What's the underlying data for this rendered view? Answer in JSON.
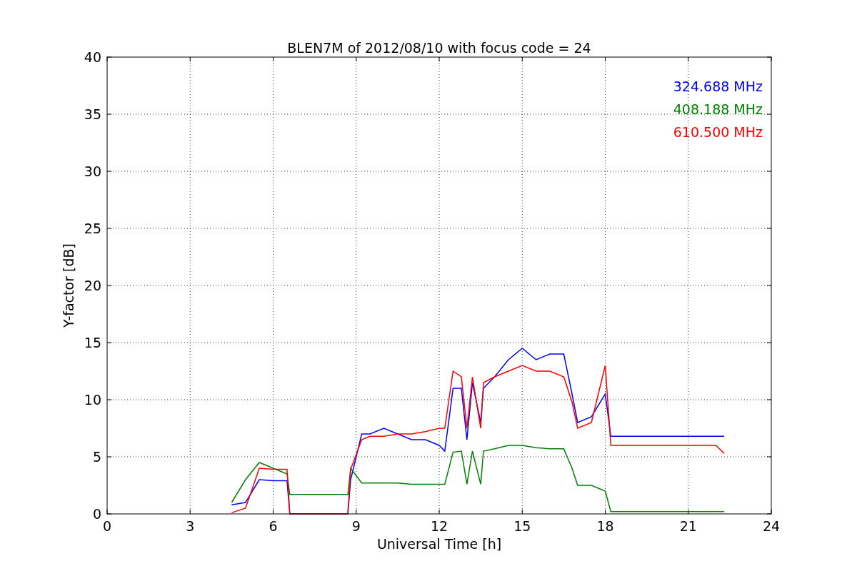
{
  "figure": {
    "chart_data": {
      "type": "line",
      "title": "BLEN7M of 2012/08/10 with focus code = 24",
      "xlabel": "Universal Time [h]",
      "ylabel": "Y-factor [dB]",
      "x": [
        4.5,
        5,
        5.5,
        6,
        6.5,
        6.6,
        8.7,
        8.8,
        9.2,
        9.5,
        10,
        10.5,
        11,
        11.5,
        12,
        12.2,
        12.5,
        12.8,
        13,
        13.2,
        13.5,
        13.6,
        14,
        14.5,
        15,
        15.5,
        16,
        16.5,
        16.8,
        17,
        17.5,
        18,
        18.2,
        20,
        22,
        22.3
      ],
      "series": [
        {
          "name": "324.688 MHz",
          "color": "#0000ff",
          "values": [
            0.8,
            1,
            3,
            2.9,
            2.9,
            0,
            0,
            3,
            7,
            7,
            7.5,
            7,
            6.5,
            6.5,
            6,
            5.5,
            11,
            11,
            6.5,
            11.5,
            8,
            11,
            12,
            13.5,
            14.5,
            13.5,
            14,
            14,
            10.5,
            8,
            8.5,
            10.5,
            6.8,
            6.8,
            6.8,
            6.8
          ]
        },
        {
          "name": "408.188 MHz",
          "color": "#008000",
          "values": [
            1,
            3,
            4.5,
            4,
            3.5,
            1.7,
            1.7,
            4,
            2.7,
            2.7,
            2.7,
            2.7,
            2.6,
            2.6,
            2.6,
            2.6,
            5.4,
            5.5,
            2.6,
            5.5,
            2.6,
            5.5,
            5.7,
            6,
            6,
            5.8,
            5.7,
            5.7,
            4,
            2.5,
            2.5,
            2,
            0.2,
            0.2,
            0.2,
            0.2
          ]
        },
        {
          "name": "610.500 MHz",
          "color": "#ff0000",
          "values": [
            0.1,
            0.5,
            4,
            3.9,
            3.9,
            0,
            0,
            3.9,
            6.5,
            6.8,
            6.8,
            7,
            7,
            7.2,
            7.5,
            7.5,
            12.5,
            12,
            7.5,
            12,
            7.5,
            11.5,
            12,
            12.5,
            13,
            12.5,
            12.5,
            12,
            9.8,
            7.5,
            8,
            13,
            6,
            6,
            6,
            5.3
          ]
        }
      ],
      "grid": true,
      "xlim": [
        0,
        24
      ],
      "ylim": [
        0,
        40
      ],
      "xticks": [
        0,
        3,
        6,
        9,
        12,
        15,
        18,
        21,
        24
      ],
      "yticks": [
        0,
        5,
        10,
        15,
        20,
        25,
        30,
        35,
        40
      ]
    }
  }
}
